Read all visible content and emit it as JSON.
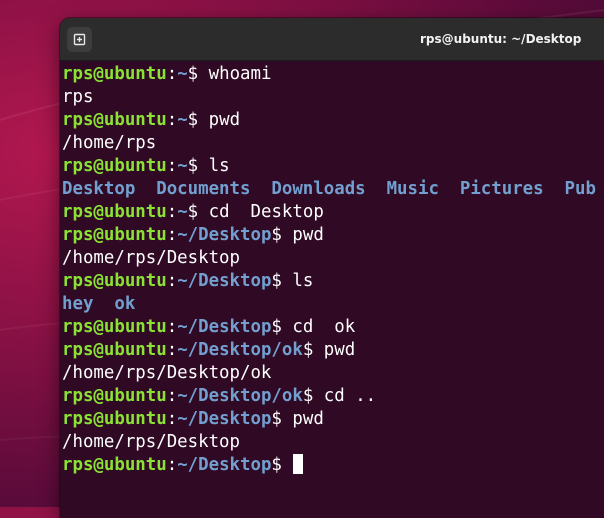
{
  "window": {
    "title": "rps@ubuntu: ~/Desktop",
    "newtab_icon": "new-tab-icon"
  },
  "colors": {
    "background": "#300a24",
    "prompt_user": "#8ae234",
    "prompt_path": "#729fcf",
    "text": "#ffffff",
    "titlebar": "#2c2c2c"
  },
  "terminal": {
    "prompt_user": "rps@ubuntu",
    "lines": [
      {
        "path": "~",
        "cmd": " whoami"
      },
      {
        "out": "rps"
      },
      {
        "path": "~",
        "cmd": " pwd"
      },
      {
        "out": "/home/rps"
      },
      {
        "path": "~",
        "cmd": " ls"
      },
      {
        "dirs": "Desktop  Documents  Downloads  Music  Pictures  Pub"
      },
      {
        "path": "~",
        "cmd": " cd  Desktop"
      },
      {
        "path": "~/Desktop",
        "cmd": " pwd"
      },
      {
        "out": "/home/rps/Desktop"
      },
      {
        "path": "~/Desktop",
        "cmd": " ls"
      },
      {
        "dirs": "hey  ok"
      },
      {
        "path": "~/Desktop",
        "cmd": " cd  ok"
      },
      {
        "path": "~/Desktop/ok",
        "cmd": " pwd"
      },
      {
        "out": "/home/rps/Desktop/ok"
      },
      {
        "path": "~/Desktop/ok",
        "cmd": " cd .."
      },
      {
        "path": "~/Desktop",
        "cmd": " pwd"
      },
      {
        "out": "/home/rps/Desktop"
      },
      {
        "path": "~/Desktop",
        "cmd": " ",
        "cursor": true
      }
    ]
  }
}
